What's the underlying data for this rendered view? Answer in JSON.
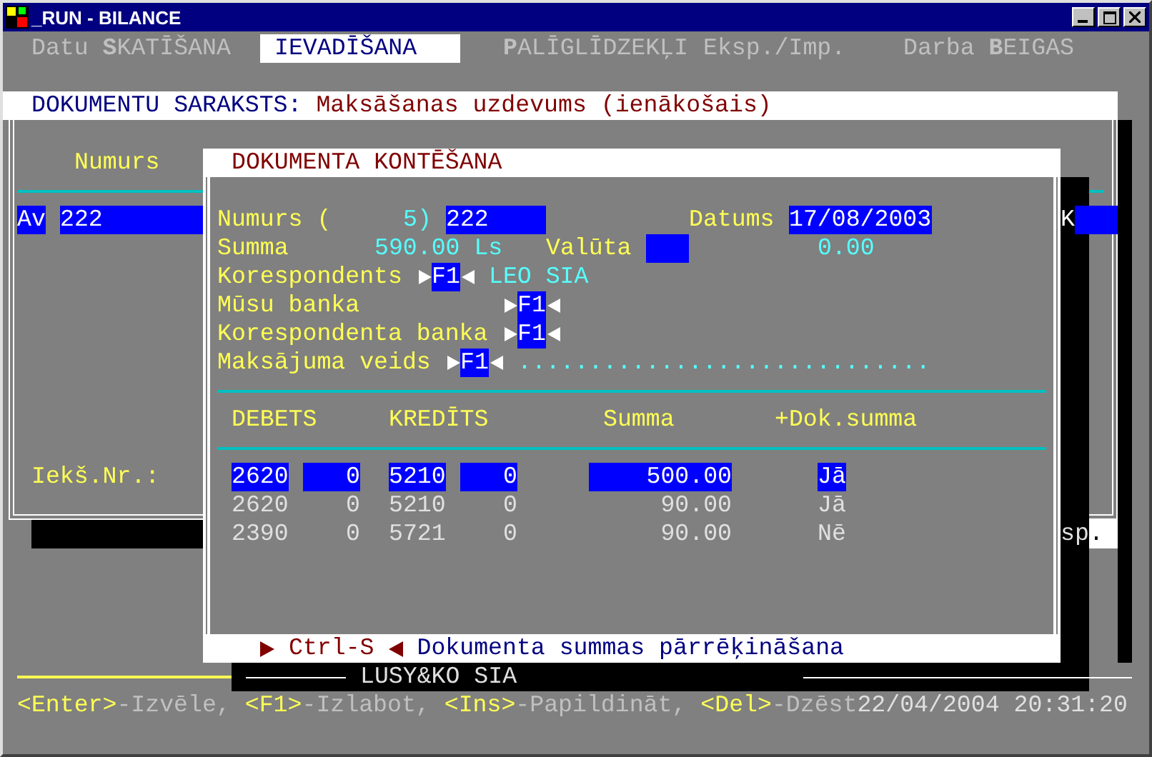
{
  "window": {
    "title": "_RUN - BILANCE"
  },
  "menu": [
    {
      "label": "Datu **S**KATĪŠANA",
      "selected": false
    },
    {
      "label": "IEVADĪŠANA",
      "selected": true
    },
    {
      "label": "**P**ALĪGLĪDZEKĻI",
      "selected": false
    },
    {
      "label": "Eksp./Imp.",
      "selected": false
    },
    {
      "label": "Darba **B**EIGAS",
      "selected": false
    }
  ],
  "list_title": {
    "prefix": "DOKUMENTU SARAKSTS:",
    "name": "Maksāšanas uzdevums (ienākošais)"
  },
  "list": {
    "column_1": "Numurs",
    "row": {
      "type": "Av",
      "number": "222",
      "column_3": "K"
    },
    "field_label": "Iekš.Nr.:",
    "fragment": "sp",
    "cursor_text": "."
  },
  "dialog": {
    "title": "DOKUMENTA KONTĒŠANA",
    "number_label": "Numurs (",
    "number_count": "5)",
    "number": "222",
    "date_label": "Datums",
    "date": "17/08/2003",
    "sum_label": "Summa",
    "sum": "590.00 Ls",
    "currency_label": "Valūta",
    "currency_amount": "0.00",
    "lookups": [
      {
        "label": "Korespondents",
        "key": "F1",
        "value": "LEO SIA"
      },
      {
        "label": "Mūsu banka",
        "key": "F1"
      },
      {
        "label": "Korespondenta banka",
        "key": "F1"
      },
      {
        "label": "Maksājuma veids",
        "key": "F1",
        "value": "............................."
      }
    ],
    "columns": [
      "DEBETS",
      "KREDĪTS",
      "Summa",
      "+Dok.summa"
    ],
    "rows": [
      {
        "debit": "2620",
        "debit_sub": "0",
        "credit": "5210",
        "credit_sub": "0",
        "sum": "500.00",
        "flag": "Jā",
        "selected": true
      },
      {
        "debit": "2620",
        "debit_sub": "0",
        "credit": "5210",
        "credit_sub": "0",
        "sum": "90.00",
        "flag": "Jā",
        "selected": false
      },
      {
        "debit": "2390",
        "debit_sub": "0",
        "credit": "5721",
        "credit_sub": "0",
        "sum": "90.00",
        "flag": "Nē",
        "selected": false
      }
    ],
    "hint": {
      "key": "Ctrl-S",
      "text": "Dokumenta summas pārrēķināšana"
    }
  },
  "status_bar": {
    "company": "LUSY&KO SIA",
    "hints": [
      {
        "key": "<Enter>",
        "action": "-Izvēle,"
      },
      {
        "key": "<F1>",
        "action": "-Izlabot,"
      },
      {
        "key": "<Ins>",
        "action": "-Papildināt,"
      },
      {
        "key": "<Del>",
        "action": "-Dzēst"
      }
    ],
    "datetime": "22/04/2004 20:31:20"
  }
}
